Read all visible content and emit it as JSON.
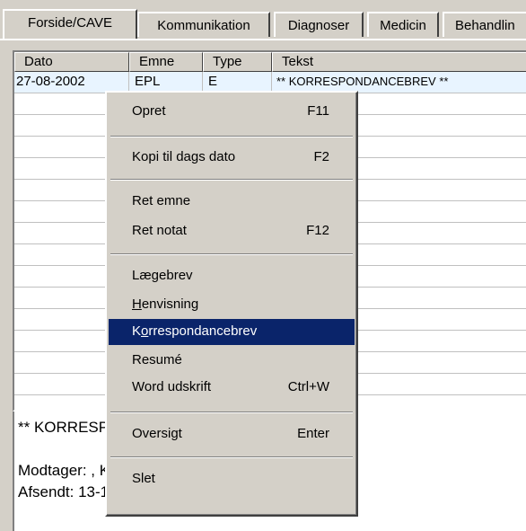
{
  "tabs": [
    "Forside/CAVE",
    "Kommunikation",
    "Diagnoser",
    "Medicin",
    "Behandlin"
  ],
  "table": {
    "columns": [
      "Dato",
      "Emne",
      "Type",
      "Tekst"
    ],
    "rows": [
      {
        "dato": "27-08-2002",
        "emne": "EPL",
        "type": "E",
        "tekst": "** KORRESPONDANCEBREV **"
      }
    ]
  },
  "note": {
    "line1": "** KORRESPONDANCEBREV **",
    "line2": "",
    "line3": "Modtager: , KIRURGISK AFD",
    "line4": "Afsendt: 13-12-1998 kl. 12:02"
  },
  "context_menu": {
    "opret": {
      "label": "Opret",
      "shortcut": "F11"
    },
    "kopi": {
      "label": "Kopi til dags dato",
      "shortcut": "F2"
    },
    "ret_emne": {
      "label": "Ret emne"
    },
    "ret_notat": {
      "label": "Ret notat",
      "shortcut": "F12"
    },
    "laegebrev": {
      "label": "Lægebrev"
    },
    "henvisning": {
      "prefix": "",
      "accel": "H",
      "suffix": "envisning"
    },
    "korrespondancebrev": {
      "prefix": "K",
      "accel": "o",
      "suffix": "rrespondancebrev"
    },
    "resume": {
      "label": "Resumé"
    },
    "word": {
      "label": "Word udskrift",
      "shortcut": "Ctrl+W"
    },
    "oversigt": {
      "label": "Oversigt",
      "shortcut": "Enter"
    },
    "slet": {
      "label": "Slet"
    }
  },
  "colors": {
    "highlight": "#0a246a",
    "face": "#d4d0c8"
  }
}
